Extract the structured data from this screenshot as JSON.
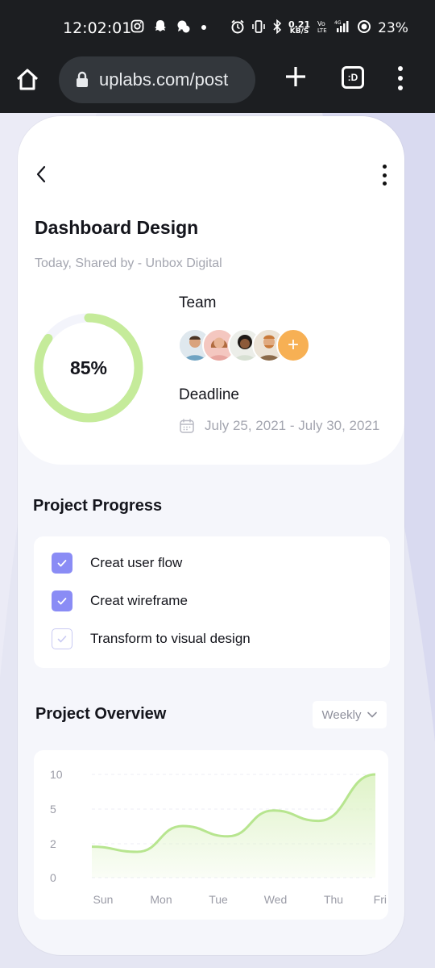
{
  "status_bar": {
    "time": "12:02:01",
    "speed_top": "0.21",
    "speed_bottom": "KB/S",
    "battery": "23%"
  },
  "browser": {
    "url": "uplabs.com/post",
    "tabs_label": ":D"
  },
  "header": {
    "title": "Dashboard Design",
    "subtitle": "Today, Shared by - Unbox Digital"
  },
  "progress": {
    "percent_label": "85%",
    "value": 0.85,
    "ring_color": "#c5eb9a",
    "track_color": "#f3f4fb"
  },
  "team": {
    "label": "Team",
    "add_symbol": "+",
    "avatar_colors": [
      "#6fa3c2",
      "#e8a6a0",
      "#d7e0d3",
      "#8b6a4a"
    ]
  },
  "deadline": {
    "label": "Deadline",
    "dates": "July 25, 2021 - July 30, 2021"
  },
  "project_progress": {
    "title": "Project Progress",
    "tasks": [
      {
        "label": "Creat user flow",
        "done": true
      },
      {
        "label": "Creat wireframe",
        "done": true
      },
      {
        "label": "Transform to visual design",
        "done": false
      }
    ],
    "checkbox_color": "#8a8cf5"
  },
  "project_overview": {
    "title": "Project Overview",
    "period": "Weekly"
  },
  "chart_data": {
    "type": "area",
    "categories": [
      "Sun",
      "Mon",
      "Tue",
      "Wed",
      "Thu",
      "Fri"
    ],
    "y_ticks": [
      "10",
      "5",
      "2",
      "0"
    ],
    "series": [
      {
        "values": [
          3,
          2.5,
          5,
          4,
          6.5,
          5.5,
          10
        ]
      }
    ],
    "x_positions": [
      0,
      0.8,
      1.6,
      2.4,
      3.2,
      4.0,
      5.0
    ],
    "line_color": "#b7e58f",
    "fill_color": "#dff3c8",
    "grid": true
  }
}
